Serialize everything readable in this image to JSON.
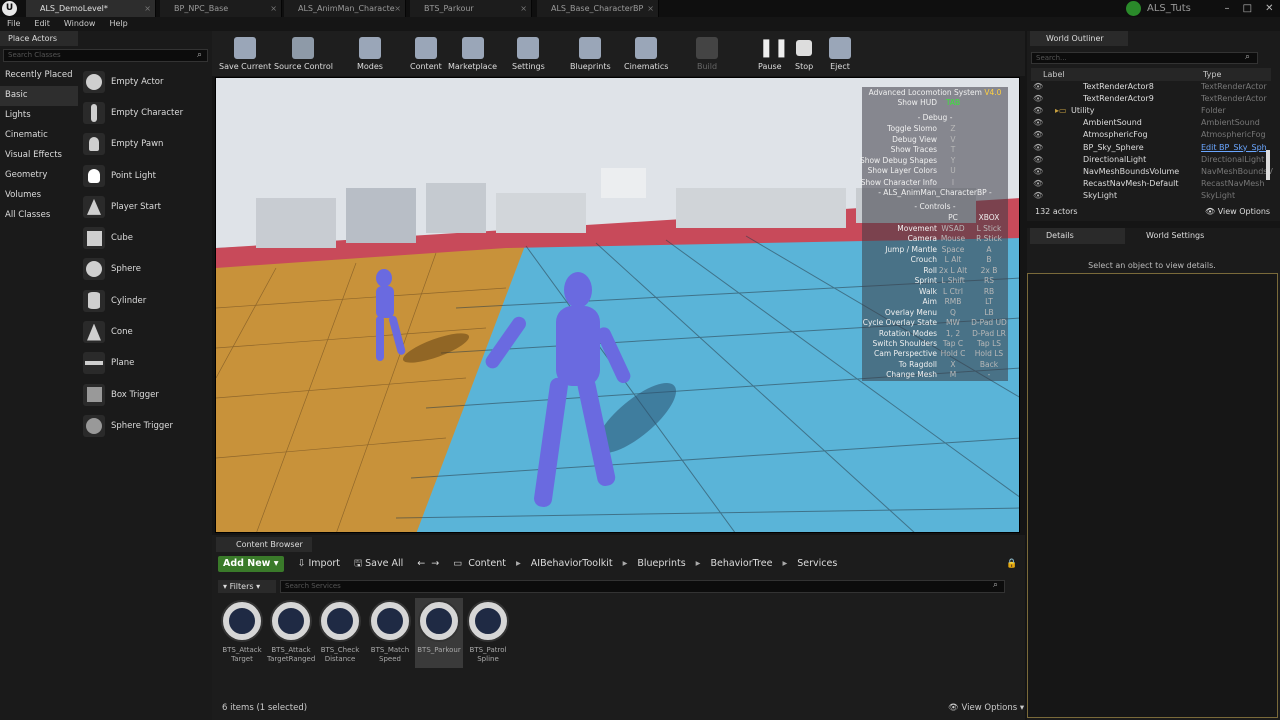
{
  "tabs": [
    {
      "label": "ALS_DemoLevel*",
      "active": true
    },
    {
      "label": "BP_NPC_Base"
    },
    {
      "label": "ALS_AnimMan_Characte"
    },
    {
      "label": "BTS_Parkour"
    },
    {
      "label": "ALS_Base_CharacterBP"
    }
  ],
  "project_name": "ALS_Tuts",
  "menu": [
    "File",
    "Edit",
    "Window",
    "Help"
  ],
  "place_actors": {
    "tab": "Place Actors",
    "search_placeholder": "Search Classes",
    "categories": [
      "Recently Placed",
      "Basic",
      "Lights",
      "Cinematic",
      "Visual Effects",
      "Geometry",
      "Volumes",
      "All Classes"
    ],
    "selected_category": "Basic",
    "items": [
      "Empty Actor",
      "Empty Character",
      "Empty Pawn",
      "Point Light",
      "Player Start",
      "Cube",
      "Sphere",
      "Cylinder",
      "Cone",
      "Plane",
      "Box Trigger",
      "Sphere Trigger"
    ]
  },
  "toolbar": {
    "save_current": "Save Current",
    "source_control": "Source Control",
    "modes": "Modes",
    "content": "Content",
    "marketplace": "Marketplace",
    "settings": "Settings",
    "blueprints": "Blueprints",
    "cinematics": "Cinematics",
    "build": "Build",
    "pause": "Pause",
    "stop": "Stop",
    "eject": "Eject"
  },
  "hud": {
    "title": "Advanced Locomotion System",
    "version": "V4.0",
    "show_hud": "Show HUD",
    "show_hud_key": "TAB",
    "debug_header": "- Debug -",
    "debug_rows": [
      {
        "label": "Toggle Slomo",
        "key": "Z"
      },
      {
        "label": "Debug View",
        "key": "V"
      },
      {
        "label": "Show Traces",
        "key": "T"
      },
      {
        "label": "Show Debug Shapes",
        "key": "Y"
      },
      {
        "label": "Show Layer Colors",
        "key": "U"
      }
    ],
    "show_char_info": "Show Character Info",
    "show_char_info_key": "I",
    "character": "- ALS_AnimMan_CharacterBP -",
    "controls_header": "- Controls -",
    "col_pc": "PC",
    "col_xbox": "XBOX",
    "controls": [
      {
        "label": "Movement",
        "pc": "WSAD",
        "xbox": "L Stick"
      },
      {
        "label": "Camera",
        "pc": "Mouse",
        "xbox": "R Stick"
      },
      {
        "label": "Jump / Mantle",
        "pc": "Space",
        "xbox": "A"
      },
      {
        "label": "Crouch",
        "pc": "L Alt",
        "xbox": "B"
      },
      {
        "label": "Roll",
        "pc": "2x L Alt",
        "xbox": "2x B"
      },
      {
        "label": "Sprint",
        "pc": "L Shift",
        "xbox": "RS"
      },
      {
        "label": "Walk",
        "pc": "L Ctrl",
        "xbox": "RB"
      },
      {
        "label": "Aim",
        "pc": "RMB",
        "xbox": "LT"
      },
      {
        "label": "Overlay Menu",
        "pc": "Q",
        "xbox": "LB"
      },
      {
        "label": "Cycle Overlay State",
        "pc": "MW",
        "xbox": "D-Pad UD"
      },
      {
        "label": "Rotation Modes",
        "pc": "1, 2",
        "xbox": "D-Pad LR"
      },
      {
        "label": "Switch Shoulders",
        "pc": "Tap C",
        "xbox": "Tap LS"
      },
      {
        "label": "Cam Perspective",
        "pc": "Hold C",
        "xbox": "Hold LS"
      },
      {
        "label": "To Ragdoll",
        "pc": "X",
        "xbox": "Back"
      },
      {
        "label": "Change Mesh",
        "pc": "M",
        "xbox": "-"
      }
    ]
  },
  "outliner": {
    "tab": "World Outliner",
    "search_placeholder": "Search...",
    "col_label": "Label",
    "col_type": "Type",
    "rows": [
      {
        "label": "TextRenderActor8",
        "type": "TextRenderActor",
        "indent": 1
      },
      {
        "label": "TextRenderActor9",
        "type": "TextRenderActor",
        "indent": 1
      },
      {
        "label": "Utility",
        "type": "Folder",
        "indent": 0
      },
      {
        "label": "AmbientSound",
        "type": "AmbientSound",
        "indent": 1
      },
      {
        "label": "AtmosphericFog",
        "type": "AtmosphericFog",
        "indent": 1
      },
      {
        "label": "BP_Sky_Sphere",
        "type": "Edit BP_Sky_Sph",
        "indent": 1,
        "link": true
      },
      {
        "label": "DirectionalLight",
        "type": "DirectionalLight",
        "indent": 1
      },
      {
        "label": "NavMeshBoundsVolume",
        "type": "NavMeshBoundsV",
        "indent": 1
      },
      {
        "label": "RecastNavMesh-Default",
        "type": "RecastNavMesh",
        "indent": 1
      },
      {
        "label": "SkyLight",
        "type": "SkyLight",
        "indent": 1
      }
    ],
    "actor_count": "132 actors",
    "view_options": "View Options"
  },
  "details": {
    "tab": "Details",
    "world_settings_tab": "World Settings",
    "empty_message": "Select an object to view details."
  },
  "content_browser": {
    "tab": "Content Browser",
    "add_new": "Add New",
    "import": "Import",
    "save_all": "Save All",
    "breadcrumbs": [
      "Content",
      "AIBehaviorToolkit",
      "Blueprints",
      "BehaviorTree",
      "Services"
    ],
    "filters": "Filters",
    "search_placeholder": "Search Services",
    "assets": [
      {
        "line1": "BTS_Attack",
        "line2": "Target"
      },
      {
        "line1": "BTS_Attack",
        "line2": "TargetRanged"
      },
      {
        "line1": "BTS_Check",
        "line2": "Distance"
      },
      {
        "line1": "BTS_Match",
        "line2": "Speed"
      },
      {
        "line1": "BTS_Parkour",
        "line2": "",
        "selected": true
      },
      {
        "line1": "BTS_Patrol",
        "line2": "Spline"
      }
    ],
    "item_count": "6 items (1 selected)",
    "view_options": "View Options"
  },
  "colors": {
    "accent_green": "#3a7a2a",
    "floor_blue": "#5ab4d8",
    "floor_orange": "#c8923a",
    "mannequin": "#6a6ae0",
    "wall_red": "#c84a5a",
    "hud_key_green": "#37e837"
  }
}
